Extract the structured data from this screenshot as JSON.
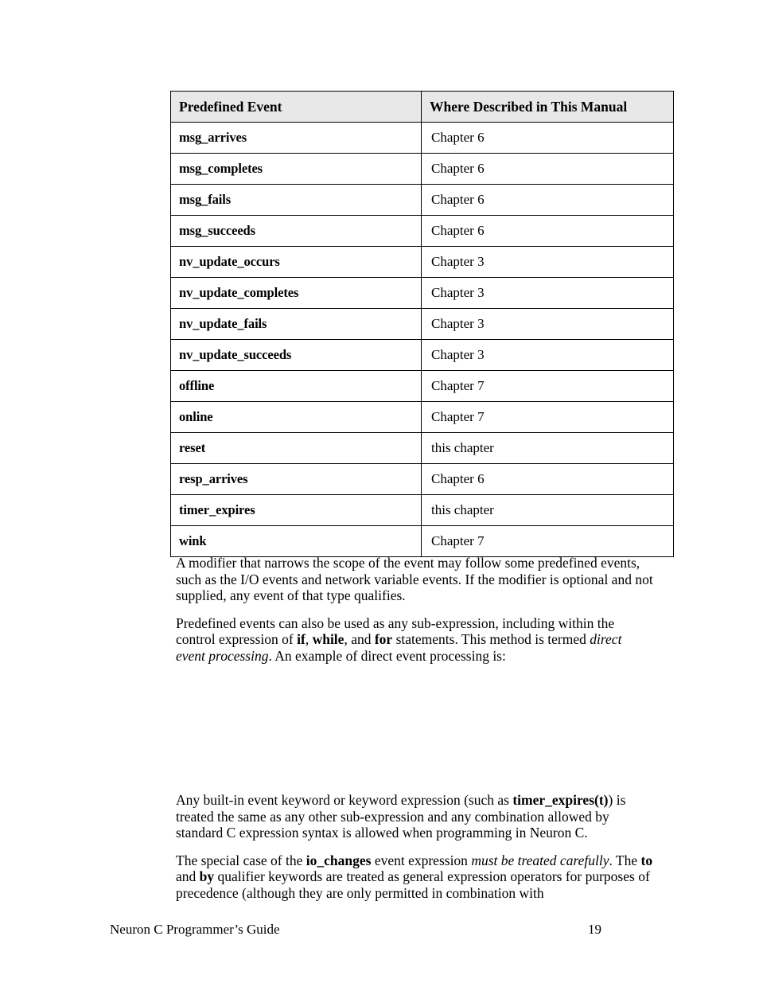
{
  "document": {
    "footer_title": "Neuron C Programmer’s Guide",
    "page_number": "19"
  },
  "table": {
    "headers": {
      "event": "Predefined Event",
      "where": "Where Described in This Manual"
    },
    "header_background": "#e8e8e8",
    "rows": [
      {
        "event": "msg_arrives",
        "where": "Chapter 6"
      },
      {
        "event": "msg_completes",
        "where": "Chapter 6"
      },
      {
        "event": "msg_fails",
        "where": "Chapter 6"
      },
      {
        "event": "msg_succeeds",
        "where": "Chapter 6"
      },
      {
        "event": "nv_update_occurs",
        "where": "Chapter 3"
      },
      {
        "event": "nv_update_completes",
        "where": "Chapter 3"
      },
      {
        "event": "nv_update_fails",
        "where": "Chapter 3"
      },
      {
        "event": "nv_update_succeeds",
        "where": "Chapter 3"
      },
      {
        "event": "offline",
        "where": "Chapter 7"
      },
      {
        "event": "online",
        "where": "Chapter 7"
      },
      {
        "event": "reset",
        "where": "this chapter"
      },
      {
        "event": "resp_arrives",
        "where": "Chapter 6"
      },
      {
        "event": "timer_expires",
        "where": "this chapter"
      },
      {
        "event": "wink",
        "where": "Chapter 7"
      }
    ]
  },
  "paragraphs": {
    "p1": {
      "s1": "A modifier that narrows the scope of the event may follow some predefined events, such as the I/O events and network variable events.  If the modifier is optional and not supplied, any event of that type qualifies."
    },
    "p2": {
      "s1": "Predefined events can also be used as any sub-expression, including within the control expression of ",
      "kw_if": "if",
      "s2": ", ",
      "kw_while": "while",
      "s3": ", and ",
      "kw_for": "for",
      "s4": " statements.  This method is termed ",
      "em1": "direct event processing",
      "s5": ".  An example of direct event processing is:"
    },
    "p3": {
      "s1": "Any built-in event keyword or keyword expression (such as ",
      "kw1": "timer_expires(t)",
      "s2": ") is treated the same as any other sub-expression and any combination allowed by standard C expression syntax is allowed when programming in Neuron C."
    },
    "p4": {
      "s1": "The special case of the ",
      "kw1": "io_changes",
      "s2": " event expression ",
      "em1": "must be treated carefully",
      "s3": ".  The ",
      "kw2": "to",
      "s4": " and ",
      "kw3": "by",
      "s5": " qualifier keywords are treated as general expression operators for purposes of precedence (although they are only permitted in combination with"
    }
  }
}
